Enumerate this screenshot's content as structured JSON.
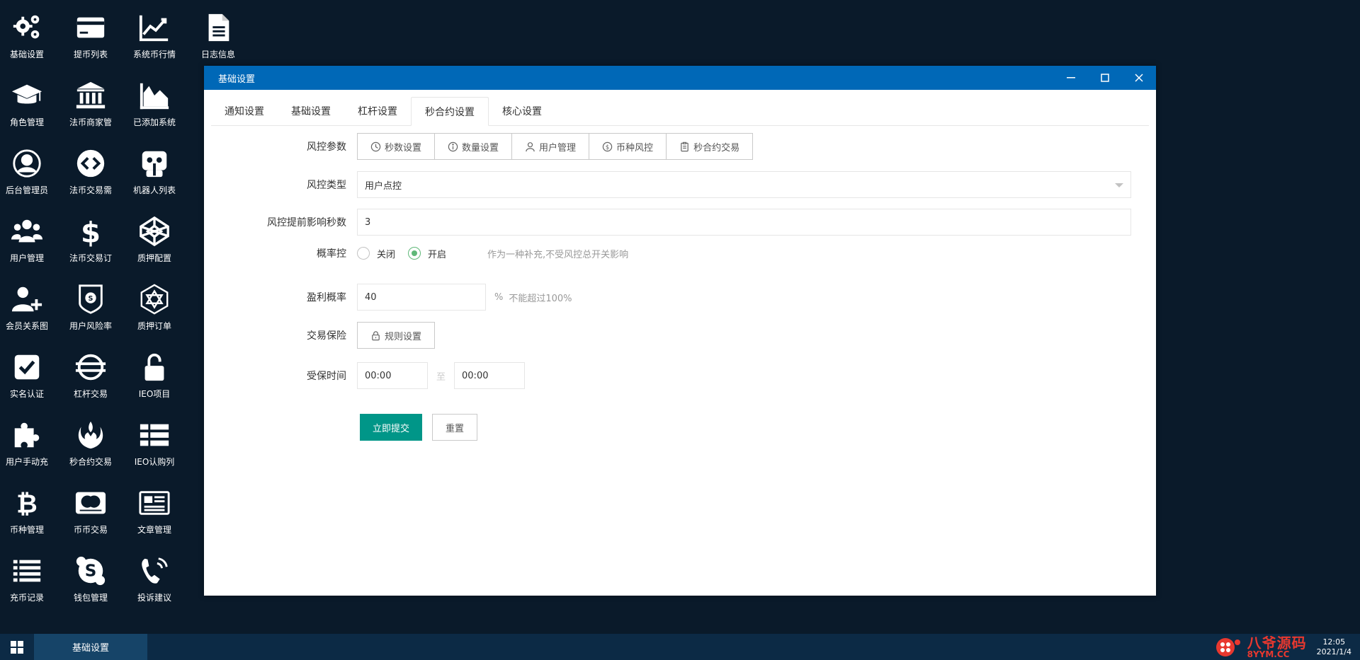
{
  "desktop": {
    "icons": [
      {
        "label": "基础设置",
        "icon": "gears-icon"
      },
      {
        "label": "提币列表",
        "icon": "credit-card-icon"
      },
      {
        "label": "系统币行情",
        "icon": "line-chart-icon"
      },
      {
        "label": "日志信息",
        "icon": "document-icon"
      },
      {
        "label": "角色管理",
        "icon": "graduation-cap-icon"
      },
      {
        "label": "法币商家管",
        "icon": "bank-icon"
      },
      {
        "label": "已添加系统",
        "icon": "area-chart-icon"
      },
      {
        "label": "后台管理员",
        "icon": "user-circle-icon"
      },
      {
        "label": "法币交易需",
        "icon": "exchange-icon"
      },
      {
        "label": "机器人列表",
        "icon": "robot-icon"
      },
      {
        "label": "用户管理",
        "icon": "users-icon"
      },
      {
        "label": "法币交易订",
        "icon": "dollar-icon"
      },
      {
        "label": "质押配置",
        "icon": "codepen-icon"
      },
      {
        "label": "会员关系图",
        "icon": "user-plus-icon"
      },
      {
        "label": "用户风险率",
        "icon": "shield-coin-icon"
      },
      {
        "label": "质押订单",
        "icon": "hexagon-mesh-icon"
      },
      {
        "label": "实名认证",
        "icon": "checkbox-icon"
      },
      {
        "label": "杠杆交易",
        "icon": "globe-stroke-icon"
      },
      {
        "label": "IEO项目",
        "icon": "unlock-icon"
      },
      {
        "label": "用户手动充",
        "icon": "puzzle-icon"
      },
      {
        "label": "秒合约交易",
        "icon": "rebel-icon"
      },
      {
        "label": "IEO认购列",
        "icon": "list-icon"
      },
      {
        "label": "币种管理",
        "icon": "bitcoin-icon"
      },
      {
        "label": "币币交易",
        "icon": "mastercard-icon"
      },
      {
        "label": "文章管理",
        "icon": "newspaper-icon"
      },
      {
        "label": "充币记录",
        "icon": "list-bars-icon"
      },
      {
        "label": "钱包管理",
        "icon": "skype-icon"
      },
      {
        "label": "投诉建议",
        "icon": "phone-volume-icon"
      }
    ]
  },
  "window": {
    "title": "基础设置",
    "tabs": [
      {
        "label": "通知设置",
        "active": false
      },
      {
        "label": "基础设置",
        "active": false
      },
      {
        "label": "杠杆设置",
        "active": false
      },
      {
        "label": "秒合约设置",
        "active": true
      },
      {
        "label": "核心设置",
        "active": false
      }
    ],
    "form": {
      "risk_params": {
        "label": "风控参数",
        "buttons": [
          {
            "label": "秒数设置",
            "icon": "clock-icon"
          },
          {
            "label": "数量设置",
            "icon": "info-icon"
          },
          {
            "label": "用户管理",
            "icon": "user-icon"
          },
          {
            "label": "币种风控",
            "icon": "dollar-circle-icon"
          },
          {
            "label": "秒合约交易",
            "icon": "clipboard-icon"
          }
        ]
      },
      "risk_type": {
        "label": "风控类型",
        "value": "用户点控"
      },
      "risk_seconds": {
        "label": "风控提前影响秒数",
        "value": "3"
      },
      "probability": {
        "label": "概率控",
        "options": [
          {
            "label": "关闭",
            "checked": false
          },
          {
            "label": "开启",
            "checked": true
          }
        ],
        "hint": "作为一种补充,不受风控总开关影响"
      },
      "profit_rate": {
        "label": "盈利概率",
        "value": "40",
        "unit": "%",
        "hint": "不能超过100%"
      },
      "insurance": {
        "label": "交易保险",
        "button": "规则设置"
      },
      "insured_time": {
        "label": "受保时间",
        "start": "00:00",
        "separator": "至",
        "end": "00:00"
      },
      "submit_label": "立即提交",
      "reset_label": "重置"
    }
  },
  "taskbar": {
    "active_item": "基础设置",
    "logo_cn": "八爷源码",
    "logo_en": "8YYM.CC",
    "clock_time": "12:05",
    "clock_date": "2021/1/4"
  },
  "colors": {
    "desktop_bg": "#0a1a2a",
    "titlebar": "#0068b7",
    "submit": "#009688",
    "radio_checked": "#5fb878",
    "taskbar": "#0c2a45"
  }
}
